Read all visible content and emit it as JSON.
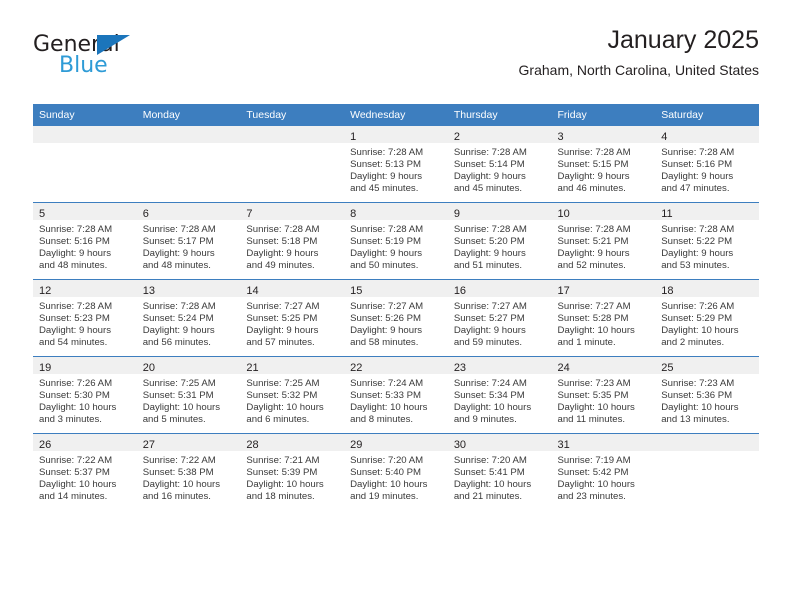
{
  "logo": {
    "word_top": "General",
    "word_bottom": "Blue",
    "triangle_color": "#1b75bb",
    "bottom_color": "#2e9bd6"
  },
  "header": {
    "title": "January 2025",
    "subtitle": "Graham, North Carolina, United States"
  },
  "theme": {
    "header_blue": "#3d7ebf",
    "daynum_band": "#f0f0f0",
    "text": "#231f20"
  },
  "weekday_headers": [
    "Sunday",
    "Monday",
    "Tuesday",
    "Wednesday",
    "Thursday",
    "Friday",
    "Saturday"
  ],
  "weeks": [
    [
      {
        "day": "",
        "empty": true
      },
      {
        "day": "",
        "empty": true
      },
      {
        "day": "",
        "empty": true
      },
      {
        "day": "1",
        "sunrise": "Sunrise: 7:28 AM",
        "sunset": "Sunset: 5:13 PM",
        "daylight1": "Daylight: 9 hours",
        "daylight2": "and 45 minutes."
      },
      {
        "day": "2",
        "sunrise": "Sunrise: 7:28 AM",
        "sunset": "Sunset: 5:14 PM",
        "daylight1": "Daylight: 9 hours",
        "daylight2": "and 45 minutes."
      },
      {
        "day": "3",
        "sunrise": "Sunrise: 7:28 AM",
        "sunset": "Sunset: 5:15 PM",
        "daylight1": "Daylight: 9 hours",
        "daylight2": "and 46 minutes."
      },
      {
        "day": "4",
        "sunrise": "Sunrise: 7:28 AM",
        "sunset": "Sunset: 5:16 PM",
        "daylight1": "Daylight: 9 hours",
        "daylight2": "and 47 minutes."
      }
    ],
    [
      {
        "day": "5",
        "sunrise": "Sunrise: 7:28 AM",
        "sunset": "Sunset: 5:16 PM",
        "daylight1": "Daylight: 9 hours",
        "daylight2": "and 48 minutes."
      },
      {
        "day": "6",
        "sunrise": "Sunrise: 7:28 AM",
        "sunset": "Sunset: 5:17 PM",
        "daylight1": "Daylight: 9 hours",
        "daylight2": "and 48 minutes."
      },
      {
        "day": "7",
        "sunrise": "Sunrise: 7:28 AM",
        "sunset": "Sunset: 5:18 PM",
        "daylight1": "Daylight: 9 hours",
        "daylight2": "and 49 minutes."
      },
      {
        "day": "8",
        "sunrise": "Sunrise: 7:28 AM",
        "sunset": "Sunset: 5:19 PM",
        "daylight1": "Daylight: 9 hours",
        "daylight2": "and 50 minutes."
      },
      {
        "day": "9",
        "sunrise": "Sunrise: 7:28 AM",
        "sunset": "Sunset: 5:20 PM",
        "daylight1": "Daylight: 9 hours",
        "daylight2": "and 51 minutes."
      },
      {
        "day": "10",
        "sunrise": "Sunrise: 7:28 AM",
        "sunset": "Sunset: 5:21 PM",
        "daylight1": "Daylight: 9 hours",
        "daylight2": "and 52 minutes."
      },
      {
        "day": "11",
        "sunrise": "Sunrise: 7:28 AM",
        "sunset": "Sunset: 5:22 PM",
        "daylight1": "Daylight: 9 hours",
        "daylight2": "and 53 minutes."
      }
    ],
    [
      {
        "day": "12",
        "sunrise": "Sunrise: 7:28 AM",
        "sunset": "Sunset: 5:23 PM",
        "daylight1": "Daylight: 9 hours",
        "daylight2": "and 54 minutes."
      },
      {
        "day": "13",
        "sunrise": "Sunrise: 7:28 AM",
        "sunset": "Sunset: 5:24 PM",
        "daylight1": "Daylight: 9 hours",
        "daylight2": "and 56 minutes."
      },
      {
        "day": "14",
        "sunrise": "Sunrise: 7:27 AM",
        "sunset": "Sunset: 5:25 PM",
        "daylight1": "Daylight: 9 hours",
        "daylight2": "and 57 minutes."
      },
      {
        "day": "15",
        "sunrise": "Sunrise: 7:27 AM",
        "sunset": "Sunset: 5:26 PM",
        "daylight1": "Daylight: 9 hours",
        "daylight2": "and 58 minutes."
      },
      {
        "day": "16",
        "sunrise": "Sunrise: 7:27 AM",
        "sunset": "Sunset: 5:27 PM",
        "daylight1": "Daylight: 9 hours",
        "daylight2": "and 59 minutes."
      },
      {
        "day": "17",
        "sunrise": "Sunrise: 7:27 AM",
        "sunset": "Sunset: 5:28 PM",
        "daylight1": "Daylight: 10 hours",
        "daylight2": "and 1 minute."
      },
      {
        "day": "18",
        "sunrise": "Sunrise: 7:26 AM",
        "sunset": "Sunset: 5:29 PM",
        "daylight1": "Daylight: 10 hours",
        "daylight2": "and 2 minutes."
      }
    ],
    [
      {
        "day": "19",
        "sunrise": "Sunrise: 7:26 AM",
        "sunset": "Sunset: 5:30 PM",
        "daylight1": "Daylight: 10 hours",
        "daylight2": "and 3 minutes."
      },
      {
        "day": "20",
        "sunrise": "Sunrise: 7:25 AM",
        "sunset": "Sunset: 5:31 PM",
        "daylight1": "Daylight: 10 hours",
        "daylight2": "and 5 minutes."
      },
      {
        "day": "21",
        "sunrise": "Sunrise: 7:25 AM",
        "sunset": "Sunset: 5:32 PM",
        "daylight1": "Daylight: 10 hours",
        "daylight2": "and 6 minutes."
      },
      {
        "day": "22",
        "sunrise": "Sunrise: 7:24 AM",
        "sunset": "Sunset: 5:33 PM",
        "daylight1": "Daylight: 10 hours",
        "daylight2": "and 8 minutes."
      },
      {
        "day": "23",
        "sunrise": "Sunrise: 7:24 AM",
        "sunset": "Sunset: 5:34 PM",
        "daylight1": "Daylight: 10 hours",
        "daylight2": "and 9 minutes."
      },
      {
        "day": "24",
        "sunrise": "Sunrise: 7:23 AM",
        "sunset": "Sunset: 5:35 PM",
        "daylight1": "Daylight: 10 hours",
        "daylight2": "and 11 minutes."
      },
      {
        "day": "25",
        "sunrise": "Sunrise: 7:23 AM",
        "sunset": "Sunset: 5:36 PM",
        "daylight1": "Daylight: 10 hours",
        "daylight2": "and 13 minutes."
      }
    ],
    [
      {
        "day": "26",
        "sunrise": "Sunrise: 7:22 AM",
        "sunset": "Sunset: 5:37 PM",
        "daylight1": "Daylight: 10 hours",
        "daylight2": "and 14 minutes."
      },
      {
        "day": "27",
        "sunrise": "Sunrise: 7:22 AM",
        "sunset": "Sunset: 5:38 PM",
        "daylight1": "Daylight: 10 hours",
        "daylight2": "and 16 minutes."
      },
      {
        "day": "28",
        "sunrise": "Sunrise: 7:21 AM",
        "sunset": "Sunset: 5:39 PM",
        "daylight1": "Daylight: 10 hours",
        "daylight2": "and 18 minutes."
      },
      {
        "day": "29",
        "sunrise": "Sunrise: 7:20 AM",
        "sunset": "Sunset: 5:40 PM",
        "daylight1": "Daylight: 10 hours",
        "daylight2": "and 19 minutes."
      },
      {
        "day": "30",
        "sunrise": "Sunrise: 7:20 AM",
        "sunset": "Sunset: 5:41 PM",
        "daylight1": "Daylight: 10 hours",
        "daylight2": "and 21 minutes."
      },
      {
        "day": "31",
        "sunrise": "Sunrise: 7:19 AM",
        "sunset": "Sunset: 5:42 PM",
        "daylight1": "Daylight: 10 hours",
        "daylight2": "and 23 minutes."
      },
      {
        "day": "",
        "empty": true
      }
    ]
  ]
}
